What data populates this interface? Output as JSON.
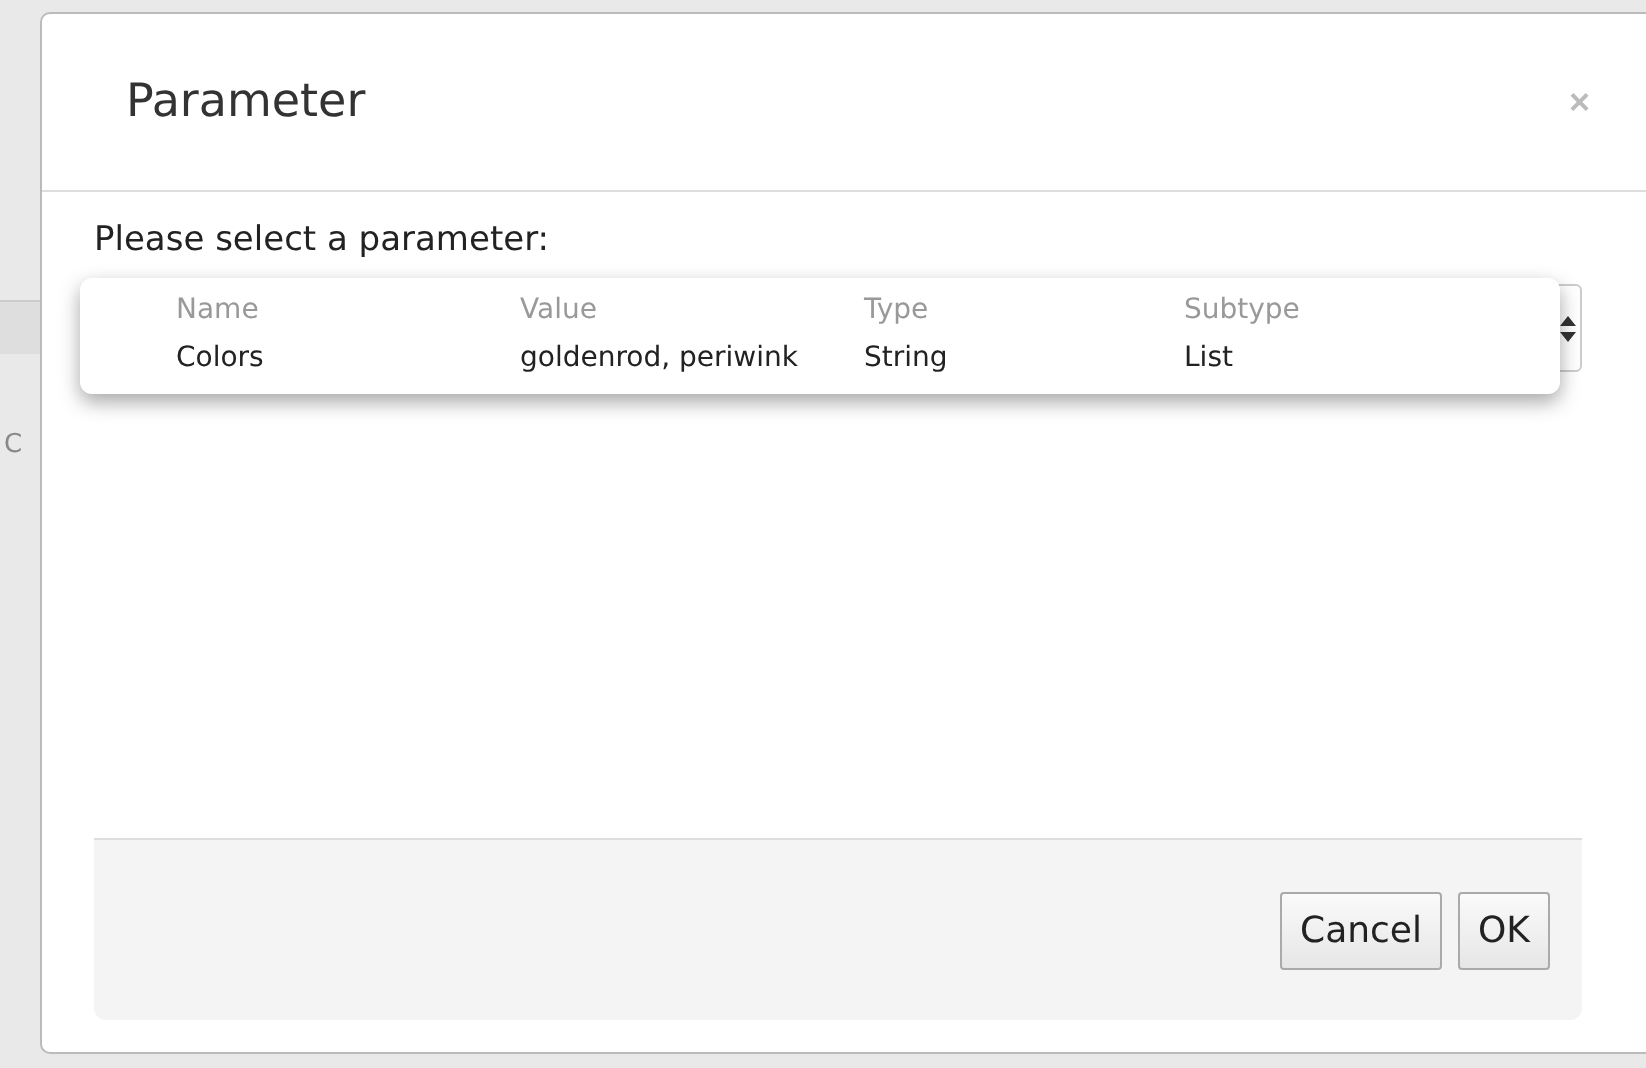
{
  "background": {
    "text": "C"
  },
  "dialog": {
    "title": "Parameter",
    "close": "×",
    "prompt": "Please select a parameter:",
    "dropdown": {
      "columns": [
        "Name",
        "Value",
        "Type",
        "Subtype"
      ],
      "options": [
        {
          "cells": [
            "Colors",
            "goldenrod, periwink",
            "String",
            "List"
          ]
        }
      ]
    },
    "buttons": [
      "Cancel",
      "OK"
    ]
  }
}
